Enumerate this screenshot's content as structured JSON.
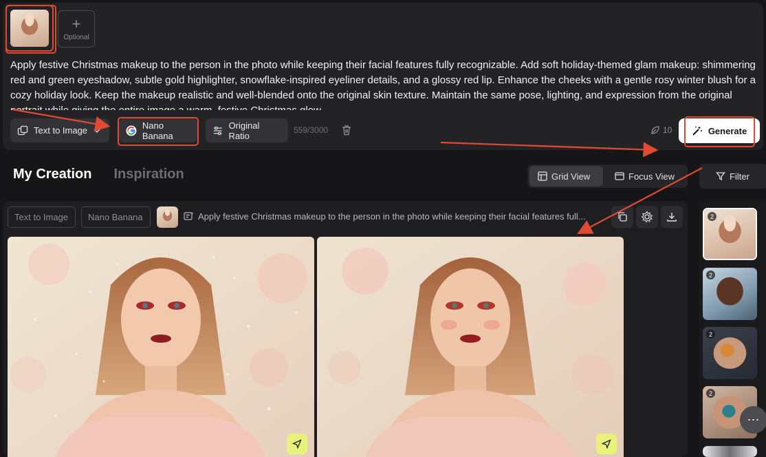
{
  "upload": {
    "optional_label": "Optional",
    "add_symbol": "+"
  },
  "prompt": {
    "text": "Apply festive Christmas makeup to the person in the photo while keeping their facial features fully recognizable. Add soft holiday-themed glam makeup: shimmering red and green eyeshadow, subtle gold highlighter, snowflake-inspired eyeliner details, and a glossy red lip. Enhance the cheeks with a gentle rosy winter blush for a cozy holiday look. Keep the makeup realistic and well-blended onto the original skin texture. Maintain the same pose, lighting, and expression from the original portrait while giving the entire image a warm, festive Christmas glow."
  },
  "toolbar": {
    "mode_label": "Text to Image",
    "model_label": "Nano Banana",
    "ratio_label": "Original Ratio",
    "counter": "559/3000",
    "credits": "10",
    "generate_label": "Generate"
  },
  "tabs": {
    "my_creation": "My Creation",
    "inspiration": "Inspiration"
  },
  "view": {
    "grid_label": "Grid View",
    "focus_label": "Focus View",
    "filter_label": "Filter"
  },
  "creation": {
    "mode_chip": "Text to Image",
    "model_chip": "Nano Banana",
    "caption": "Apply festive Christmas makeup to the person in the photo while keeping their facial features full..."
  },
  "sidebar": {
    "thumbs": [
      {
        "count": "2"
      },
      {
        "count": "2"
      },
      {
        "count": "2"
      },
      {
        "count": "2"
      }
    ],
    "more_symbol": "⋯"
  },
  "colors": {
    "accent_red": "#e04a33",
    "share_yellow": "#e8f27a"
  }
}
